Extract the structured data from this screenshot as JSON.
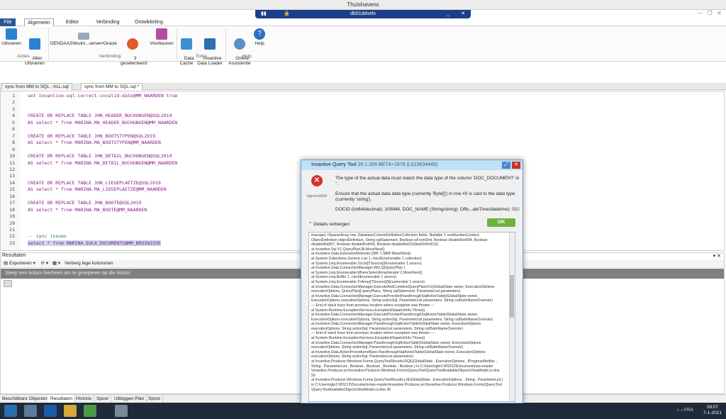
{
  "window": {
    "title": "Thuishavens",
    "remote_host": "db01ddsels",
    "buttons": [
      "minimize",
      "maximize",
      "close"
    ]
  },
  "menu": {
    "file": "File",
    "tabs": [
      "Algemeen",
      "Editor",
      "Verbinding",
      "Ontwikkeling"
    ],
    "active": "Algemeen"
  },
  "ribbon": {
    "run": "Uitvoeren",
    "run_all": "Alles\nUitvoeren",
    "connection": "DENDAAS\\bruini...server•Oracle",
    "selected": "3\ngeselecteerd",
    "preferences": "Voorkeuren",
    "data_cache": "Data\nCache",
    "data_loader": "Invantive\nData Loader",
    "online_help": "Online\nAssistentie",
    "help": "Help",
    "groups": {
      "actions": "Acties",
      "connection": "Verbinding",
      "extra": "Extra",
      "help": "Help"
    }
  },
  "doc_tabs": [
    {
      "label": "sync from MM to SQL - ALL.sql"
    },
    {
      "label": "sync from MM to SQL.sql *"
    }
  ],
  "editor": {
    "lines": [
      {
        "n": "1",
        "text": "set invantive-sql-correct-invalid-date@MM_NAARDEN true",
        "style": ""
      },
      {
        "n": "2",
        "text": "",
        "style": ""
      },
      {
        "n": "3",
        "text": "",
        "style": ""
      },
      {
        "n": "4",
        "text": "CREATE OR REPLACE TABLE JHN_HEADER_BUCHUNGEN@SQL2019",
        "style": ""
      },
      {
        "n": "5",
        "text": "AS select * from MARINA.MA_HEADER_BUCHUNGEN@MM_NAARDEN",
        "style": ""
      },
      {
        "n": "6",
        "text": "",
        "style": ""
      },
      {
        "n": "7",
        "text": "CREATE OR REPLACE TABLE JHN_BOOTSTYPEN@SQL2019",
        "style": ""
      },
      {
        "n": "8",
        "text": "AS select * from MARINA.MA_BOOTSTYPEN@MM_NAARDEN",
        "style": ""
      },
      {
        "n": "9",
        "text": "",
        "style": ""
      },
      {
        "n": "10",
        "text": "CREATE OR REPLACE TABLE JHN_DETAIL_BUCHUNGEN@SQL2019",
        "style": ""
      },
      {
        "n": "11",
        "text": "AS select * from MARINA.MA_DETAIL_BUCHUNGEN@MM_NAARDEN",
        "style": ""
      },
      {
        "n": "12",
        "text": "",
        "style": ""
      },
      {
        "n": "13",
        "text": "",
        "style": ""
      },
      {
        "n": "14",
        "text": "CREATE OR REPLACE TABLE JHN_LIEGEPLAETZE@SQL2019",
        "style": ""
      },
      {
        "n": "15",
        "text": "AS select * from MARINA.MA_LIEGEPLAETZE@MM_NAARDEN",
        "style": ""
      },
      {
        "n": "16",
        "text": "",
        "style": ""
      },
      {
        "n": "17",
        "text": "CREATE OR REPLACE TABLE JHN_BOOTE@SQL2019",
        "style": ""
      },
      {
        "n": "18",
        "text": "AS select * from MARINA.MA_BOOTE@MM_NAARDEN",
        "style": ""
      },
      {
        "n": "19",
        "text": "",
        "style": ""
      },
      {
        "n": "20",
        "text": "",
        "style": ""
      },
      {
        "n": "21",
        "text": "",
        "style": ""
      },
      {
        "n": "22",
        "text": "-- sync issues",
        "style": "cm"
      },
      {
        "n": "23",
        "text": "select * from MARINA.EUL4_DOCUMENTS@MM_BRUINISSE",
        "style": "hl"
      }
    ]
  },
  "results": {
    "title": "Resultaten",
    "export": "Exporteren",
    "hide_empty": "Verberg lege kolommen",
    "group_hint": "Sleep een kolom hierheen om te groeperen op die kolom"
  },
  "bottom_tabs": [
    "Beschikbare Objecten",
    "Resultaten",
    "Historie",
    "Spoor",
    "Uitleggen Plan",
    "Spoor"
  ],
  "dialog": {
    "title": "Invantive Query Tool",
    "version": "20.1.326-BETA+1878 (L623634445)",
    "error_code": "itgenrrd004",
    "message": "The type of the actual data must match the data type of the column 'DOC_DOCUMENT' in ''.",
    "hint": "Ensure that the actual data data type (currently 'Byte[]') in row #0 is cast to the data type (currently 'string').",
    "detail": "DOCID (Int64/decimal): 100944, DOC_NAME (String/string): Offe...ateTime/datetime): 01/1",
    "ok": "OK",
    "details_toggle": "Details verbergen",
    "trace": [
      "manager, ISparseArray row, DatabaseColumnDefinitionCollection fields, Nullable`1 rowNumberContext,",
      "ObjectDefinition objectDefinition, String sqlStatement, Boolean isFromDml, Boolean disableRot004, Boolean",
      "disableRot007, Boolean disableRot009, Boolean disableRot011AndOrRot013)",
      "   at Invantive.Sql.V1.QueryPlanJA.MoveNext()",
      "   at Invantive.Data.ExtensionMethods.QRF`1.MRF.MoveNext()",
      "   at System.Collections.Generic.List`1..ctor(IEnumerable`1 collection)",
      "   at System.Linq.Enumerable.ToList[TSource](IEnumerable`1 source)",
      "   at Invantive.Data.ConnectionManager.WG.Q(QueryPlan )",
      "   at System.Linq.Enumerable.WhereSelectArrayIterator`2.MoveNext()",
      "   at System.Linq.Buffer`1..ctor(IEnumerable`1 source)",
      "   at System.Linq.Enumerable.ToArray[TSource](IEnumerable`1 source)",
      "   at Invantive.Data.ConnectionManager.ExecuteAndCombineQueryPlansV1(GlobalState owner, ExecutionOptions",
      "executionOptions, QueryPlan[] queryPlans, String sqlStatement, ParameterList parameters)",
      "   at Invantive.Data.ConnectionManager.ExecuteProviderPassthroughSqlActionTable(GlobalState owner,",
      "ExecutionOptions executionOptions, String actionSql, ParameterList parameters, String callSafeNameOverrule)",
      "--- End of stack trace from previous location where exception was thrown ---",
      "   at System.Runtime.ExceptionServices.ExceptionDispatchInfo.Throw()",
      "   at Invantive.Data.ConnectionManager.ExecuteProviderPassthroughSqlActionTable(GlobalState owner,",
      "ExecutionOptions executionOptions, String actionSql, ParameterList parameters, String callSafeNameOverrule)",
      "   at Invantive.Data.ConnectionManager.PassthroughSqlActionTable(GlobalState owner, ExecutionOptions",
      "executionOptions, String actionSql, ParameterList parameters, String callSafeNameOverrule)",
      "--- End of stack trace from previous location where exception was thrown ---",
      "   at System.Runtime.ExceptionServices.ExceptionDispatchInfo.Throw()",
      "   at Invantive.Data.ConnectionManager.PassthroughSqlActionTable(GlobalState owner, ExecutionOptions",
      "executionOptions, String actionSql, ParameterList parameters, String callSafeNameOverrule)",
      "   at Invantive.Data.ActionProceduresBase.PassthroughSqlActionTable(GlobalState owner, ExecutionOptions",
      "executionOptions, String actionSql, ParameterList parameters)",
      "   at Invantive.Producer.Windows.Forms.QueryToolResults.RQE(GlobalState , ExecutionOptions , IProgressNotifier ,",
      "String , ParameterList , Boolean , Boolean , Boolean , Boolean ) in C:\\Users\\gle3.WS212\\Documents\\ws-master",
      "\\invantive.Producer.src\\Invantive.Producer.Windows.Forms\\QueryTool\\QueryToolAvailableObjectsViewModel.cs:line",
      "55",
      "   at Invantive.Producer.Windows.Forms.QueryToolResults.LIE(GlobalState , ExecutionOptions , String , ParameterList )",
      "in C:\\Users\\gle3.WS212\\Documents\\ws-master\\invantive.Producer.src\\Invantive.Producer.Windows.Forms\\QueryTool",
      "\\QueryToolAvailableObjectsViewModel.cs:line 30"
    ]
  },
  "taskbar": {
    "lang": "FRA",
    "time": "09:07",
    "date": "7-1-2021"
  },
  "colors": {
    "accent": "#2b5797",
    "ok": "#6db33f",
    "error": "#d9302c",
    "keyword": "#8a1a8a"
  }
}
